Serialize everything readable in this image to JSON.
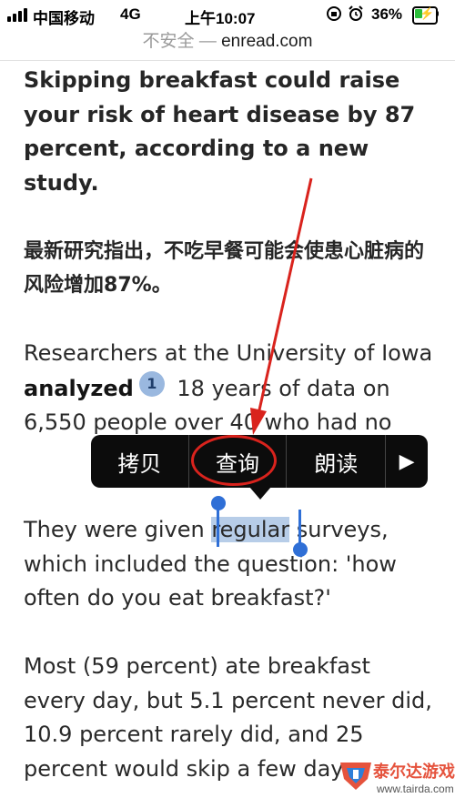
{
  "status_bar": {
    "carrier": "中国移动",
    "network": "4G",
    "time": "上午10:07",
    "battery_percent": "36%",
    "battery_level": 0.36,
    "icons": [
      "signal-icon",
      "orientation-lock-icon",
      "alarm-icon",
      "battery-charging-icon"
    ]
  },
  "url_bar": {
    "security_label": "不安全 —",
    "domain": "enread.com"
  },
  "article": {
    "headline_en": "Skipping breakfast could raise your risk of heart disease by 87 percent, according to a new study.",
    "headline_zh_prefix": "最新研究指出，不吃早餐可能会使患心脏病的风险增加",
    "headline_zh_bold": "87%",
    "headline_zh_suffix": "。",
    "p1_before": "Researchers at the University of Iowa ",
    "p1_bold": "analyzed",
    "p1_badge": "1",
    "p1_after": " 18 years of data on 6,550 people over 40 who had no",
    "p2_before": "They were given ",
    "p2_selected": "regular",
    "p2_after": " surveys, which included the question: 'how often do you eat breakfast?'",
    "p3": "Most (59 percent) ate breakfast every day, but 5.1 percent never did, 10.9 percent rarely did, and 25 percent would skip a few days"
  },
  "popup_menu": {
    "copy": "拷贝",
    "lookup": "查询",
    "speak": "朗读",
    "more": "▶"
  },
  "colors": {
    "annotation": "#d9231d",
    "selection": "#b7cde8",
    "handle": "#2f6fd6",
    "badge": "#9ab8df"
  },
  "watermark": {
    "name": "泰尔达游戏网",
    "url": "www.tairda.com"
  }
}
